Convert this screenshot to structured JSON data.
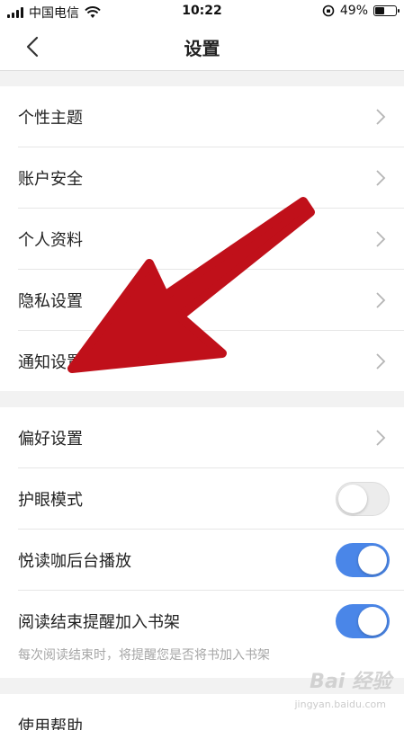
{
  "status_bar": {
    "carrier": "中国电信",
    "time": "10:22",
    "battery": "49%",
    "battery_level": 0.49
  },
  "nav": {
    "title": "设置"
  },
  "group1": [
    {
      "label": "个性主题"
    },
    {
      "label": "账户安全"
    },
    {
      "label": "个人资料"
    },
    {
      "label": "隐私设置"
    },
    {
      "label": "通知设置"
    }
  ],
  "group2": {
    "preferences": {
      "label": "偏好设置"
    },
    "eye_mode": {
      "label": "护眼模式",
      "on": false
    },
    "bg_play": {
      "label": "悦读咖后台播放",
      "on": true
    },
    "end_reminder": {
      "label": "阅读结束提醒加入书架",
      "on": true,
      "hint": "每次阅读结束时，将提醒您是否将书加入书架"
    }
  },
  "group3": {
    "help": {
      "label": "使用帮助"
    }
  },
  "colors": {
    "accent": "#4a86e8",
    "arrow": "#c0101a"
  },
  "watermark": {
    "main": "Bai 经验",
    "sub": "jingyan.baidu.com"
  }
}
